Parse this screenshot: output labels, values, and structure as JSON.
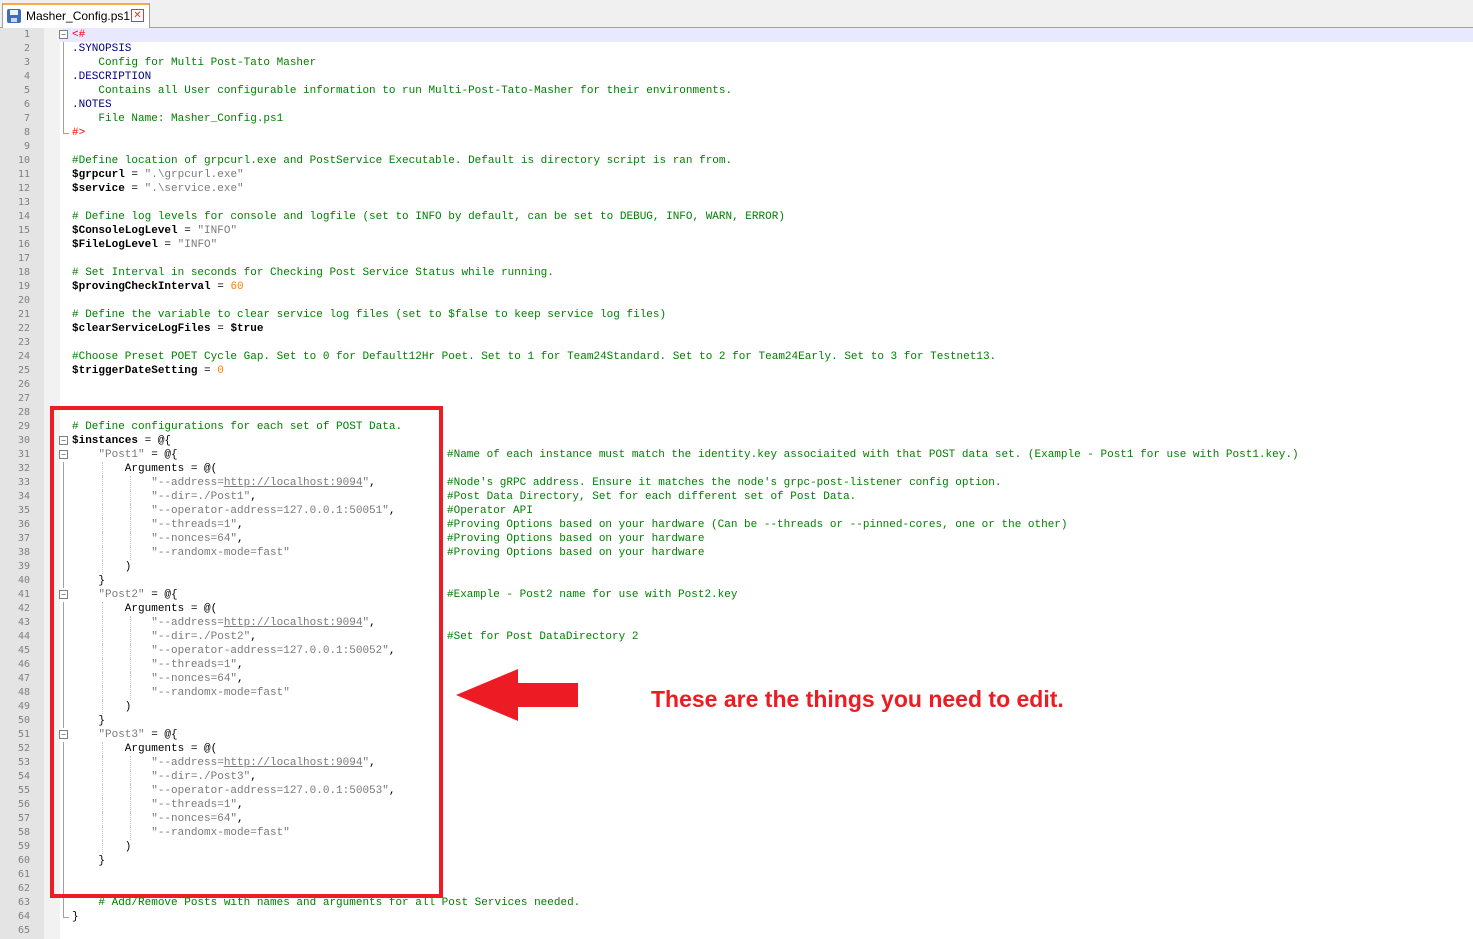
{
  "tab": {
    "label": "Masher_Config.ps1"
  },
  "lines": [
    {
      "n": "1",
      "parts": [
        {
          "text": "<#",
          "cls": "c-red"
        }
      ]
    },
    {
      "n": "2",
      "parts": [
        {
          "text": ".SYNOPSIS",
          "cls": "c-blue"
        }
      ]
    },
    {
      "n": "3",
      "parts": [
        {
          "text": "    Config for Multi Post-Tato Masher",
          "cls": "c-comment"
        }
      ]
    },
    {
      "n": "4",
      "parts": [
        {
          "text": ".DESCRIPTION",
          "cls": "c-blue"
        }
      ]
    },
    {
      "n": "5",
      "parts": [
        {
          "text": "    Contains all User configurable information to run Multi-Post-Tato-Masher for their environments.",
          "cls": "c-comment"
        }
      ]
    },
    {
      "n": "6",
      "parts": [
        {
          "text": ".NOTES",
          "cls": "c-blue"
        }
      ]
    },
    {
      "n": "7",
      "parts": [
        {
          "text": "    File Name: Masher_Config.ps1",
          "cls": "c-comment"
        }
      ]
    },
    {
      "n": "8",
      "parts": [
        {
          "text": "#>",
          "cls": "c-red"
        }
      ]
    },
    {
      "n": "9",
      "parts": []
    },
    {
      "n": "10",
      "parts": [
        {
          "text": "#Define location of grpcurl.exe and PostService Executable. Default is directory script is ran from.",
          "cls": "c-comment"
        }
      ]
    },
    {
      "n": "11",
      "parts": [
        {
          "text": "$grpcurl",
          "cls": "c-var"
        },
        {
          "text": " = "
        },
        {
          "text": "\".\\grpcurl.exe\"",
          "cls": "c-str"
        }
      ]
    },
    {
      "n": "12",
      "parts": [
        {
          "text": "$service",
          "cls": "c-var"
        },
        {
          "text": " = "
        },
        {
          "text": "\".\\service.exe\"",
          "cls": "c-str"
        }
      ]
    },
    {
      "n": "13",
      "parts": []
    },
    {
      "n": "14",
      "parts": [
        {
          "text": "# Define log levels for console and logfile (set to INFO by default, can be set to DEBUG, INFO, WARN, ERROR)",
          "cls": "c-comment"
        }
      ]
    },
    {
      "n": "15",
      "parts": [
        {
          "text": "$ConsoleLogLevel",
          "cls": "c-var"
        },
        {
          "text": " = "
        },
        {
          "text": "\"INFO\"",
          "cls": "c-str"
        }
      ]
    },
    {
      "n": "16",
      "parts": [
        {
          "text": "$FileLogLevel",
          "cls": "c-var"
        },
        {
          "text": " = "
        },
        {
          "text": "\"INFO\"",
          "cls": "c-str"
        }
      ]
    },
    {
      "n": "17",
      "parts": []
    },
    {
      "n": "18",
      "parts": [
        {
          "text": "# Set Interval in seconds for Checking Post Service Status while running.",
          "cls": "c-comment"
        }
      ]
    },
    {
      "n": "19",
      "parts": [
        {
          "text": "$provingCheckInterval",
          "cls": "c-var"
        },
        {
          "text": " = "
        },
        {
          "text": "60",
          "cls": "c-num"
        }
      ]
    },
    {
      "n": "20",
      "parts": []
    },
    {
      "n": "21",
      "parts": [
        {
          "text": "# Define the variable to clear service log files (set to $false to keep service log files)",
          "cls": "c-comment"
        }
      ]
    },
    {
      "n": "22",
      "parts": [
        {
          "text": "$clearServiceLogFiles",
          "cls": "c-var"
        },
        {
          "text": " = "
        },
        {
          "text": "$true",
          "cls": "c-var"
        }
      ]
    },
    {
      "n": "23",
      "parts": []
    },
    {
      "n": "24",
      "parts": [
        {
          "text": "#Choose Preset POET Cycle Gap. Set to 0 for Default12Hr Poet. Set to 1 for Team24Standard. Set to 2 for Team24Early. Set to 3 for Testnet13.",
          "cls": "c-comment"
        }
      ]
    },
    {
      "n": "25",
      "parts": [
        {
          "text": "$triggerDateSetting",
          "cls": "c-var"
        },
        {
          "text": " = "
        },
        {
          "text": "0",
          "cls": "c-num"
        }
      ]
    },
    {
      "n": "26",
      "parts": []
    },
    {
      "n": "27",
      "parts": []
    },
    {
      "n": "28",
      "parts": []
    },
    {
      "n": "29",
      "parts": [
        {
          "text": "# Define configurations for each set of POST Data.",
          "cls": "c-comment"
        }
      ]
    },
    {
      "n": "30",
      "parts": [
        {
          "text": "$instances",
          "cls": "c-var"
        },
        {
          "text": " = @{"
        }
      ]
    },
    {
      "n": "31",
      "parts": [
        {
          "text": "    "
        },
        {
          "text": "\"Post1\"",
          "cls": "c-str"
        },
        {
          "text": " = @{"
        }
      ],
      "note": "#Name of each instance must match the identity.key associaited with that POST data set. (Example - Post1 for use with Post1.key.)"
    },
    {
      "n": "32",
      "parts": [
        {
          "text": "        Arguments = @("
        }
      ]
    },
    {
      "n": "33",
      "parts": [
        {
          "text": "            \"--address=",
          "cls": "c-str"
        },
        {
          "text": "http://localhost:9094",
          "cls": "c-link"
        },
        {
          "text": "\"",
          "cls": "c-str"
        },
        {
          "text": ","
        }
      ],
      "note": "#Node's gRPC address. Ensure it matches the node's grpc-post-listener config option."
    },
    {
      "n": "34",
      "parts": [
        {
          "text": "            \"--dir=./Post1\"",
          "cls": "c-str"
        },
        {
          "text": ","
        }
      ],
      "note": "#Post Data Directory, Set for each different set of Post Data."
    },
    {
      "n": "35",
      "parts": [
        {
          "text": "            \"--operator-address=127.0.0.1:50051\"",
          "cls": "c-str"
        },
        {
          "text": ","
        }
      ],
      "note": "#Operator API"
    },
    {
      "n": "36",
      "parts": [
        {
          "text": "            \"--threads=1\"",
          "cls": "c-str"
        },
        {
          "text": ","
        }
      ],
      "note": "#Proving Options based on your hardware (Can be --threads or --pinned-cores, one or the other)"
    },
    {
      "n": "37",
      "parts": [
        {
          "text": "            \"--nonces=64\"",
          "cls": "c-str"
        },
        {
          "text": ","
        }
      ],
      "note": "#Proving Options based on your hardware"
    },
    {
      "n": "38",
      "parts": [
        {
          "text": "            \"--randomx-mode=fast\"",
          "cls": "c-str"
        }
      ],
      "note": "#Proving Options based on your hardware"
    },
    {
      "n": "39",
      "parts": [
        {
          "text": "        )"
        }
      ]
    },
    {
      "n": "40",
      "parts": [
        {
          "text": "    }"
        }
      ]
    },
    {
      "n": "41",
      "parts": [
        {
          "text": "    "
        },
        {
          "text": "\"Post2\"",
          "cls": "c-str"
        },
        {
          "text": " = @{"
        }
      ],
      "note": "#Example - Post2 name for use with Post2.key"
    },
    {
      "n": "42",
      "parts": [
        {
          "text": "        Arguments = @("
        }
      ]
    },
    {
      "n": "43",
      "parts": [
        {
          "text": "            \"--address=",
          "cls": "c-str"
        },
        {
          "text": "http://localhost:9094",
          "cls": "c-link"
        },
        {
          "text": "\"",
          "cls": "c-str"
        },
        {
          "text": ","
        }
      ]
    },
    {
      "n": "44",
      "parts": [
        {
          "text": "            \"--dir=./Post2\"",
          "cls": "c-str"
        },
        {
          "text": ","
        }
      ],
      "note": "#Set for Post DataDirectory 2"
    },
    {
      "n": "45",
      "parts": [
        {
          "text": "            \"--operator-address=127.0.0.1:50052\"",
          "cls": "c-str"
        },
        {
          "text": ","
        }
      ]
    },
    {
      "n": "46",
      "parts": [
        {
          "text": "            \"--threads=1\"",
          "cls": "c-str"
        },
        {
          "text": ","
        }
      ]
    },
    {
      "n": "47",
      "parts": [
        {
          "text": "            \"--nonces=64\"",
          "cls": "c-str"
        },
        {
          "text": ","
        }
      ]
    },
    {
      "n": "48",
      "parts": [
        {
          "text": "            \"--randomx-mode=fast\"",
          "cls": "c-str"
        }
      ]
    },
    {
      "n": "49",
      "parts": [
        {
          "text": "        )"
        }
      ]
    },
    {
      "n": "50",
      "parts": [
        {
          "text": "    }"
        }
      ]
    },
    {
      "n": "51",
      "parts": [
        {
          "text": "    "
        },
        {
          "text": "\"Post3\"",
          "cls": "c-str"
        },
        {
          "text": " = @{"
        }
      ]
    },
    {
      "n": "52",
      "parts": [
        {
          "text": "        Arguments = @("
        }
      ]
    },
    {
      "n": "53",
      "parts": [
        {
          "text": "            \"--address=",
          "cls": "c-str"
        },
        {
          "text": "http://localhost:9094",
          "cls": "c-link"
        },
        {
          "text": "\"",
          "cls": "c-str"
        },
        {
          "text": ","
        }
      ]
    },
    {
      "n": "54",
      "parts": [
        {
          "text": "            \"--dir=./Post3\"",
          "cls": "c-str"
        },
        {
          "text": ","
        }
      ]
    },
    {
      "n": "55",
      "parts": [
        {
          "text": "            \"--operator-address=127.0.0.1:50053\"",
          "cls": "c-str"
        },
        {
          "text": ","
        }
      ]
    },
    {
      "n": "56",
      "parts": [
        {
          "text": "            \"--threads=1\"",
          "cls": "c-str"
        },
        {
          "text": ","
        }
      ]
    },
    {
      "n": "57",
      "parts": [
        {
          "text": "            \"--nonces=64\"",
          "cls": "c-str"
        },
        {
          "text": ","
        }
      ]
    },
    {
      "n": "58",
      "parts": [
        {
          "text": "            \"--randomx-mode=fast\"",
          "cls": "c-str"
        }
      ]
    },
    {
      "n": "59",
      "parts": [
        {
          "text": "        )"
        }
      ]
    },
    {
      "n": "60",
      "parts": [
        {
          "text": "    }"
        }
      ]
    },
    {
      "n": "61",
      "parts": []
    },
    {
      "n": "62",
      "parts": []
    },
    {
      "n": "63",
      "parts": [
        {
          "text": "    # Add/Remove Posts with names and arguments for all Post Services needed.",
          "cls": "c-comment"
        }
      ]
    },
    {
      "n": "64",
      "parts": [
        {
          "text": "}"
        }
      ]
    },
    {
      "n": "65",
      "parts": []
    }
  ],
  "callout": {
    "text": "These are the things you need to edit.",
    "color": "#ed1c24"
  }
}
